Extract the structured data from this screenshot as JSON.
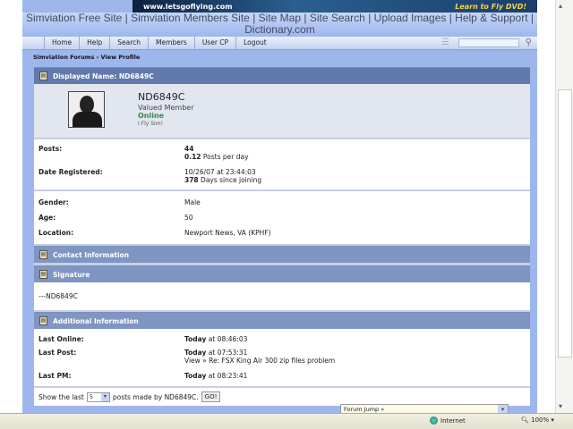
{
  "banner": {
    "left": "www.letsgoflying.com",
    "right": "Learn to Fly DVD!"
  },
  "toplinks": [
    "Simviation Free Site",
    "Simviation Members Site",
    "Site Map",
    "Site Search",
    "Upload Images",
    "Help & Support",
    "Dictionary.com"
  ],
  "menu": [
    "Home",
    "Help",
    "Search",
    "Members",
    "User CP",
    "Logout"
  ],
  "breadcrumb": "Simviation Forums › View Profile",
  "header": "Displayed Name: ND6849C",
  "profile": {
    "name": "ND6849C",
    "title": "Valued Member",
    "status": "Online",
    "motto": "I Fly Sim!"
  },
  "stats": {
    "posts_label": "Posts:",
    "posts": "44",
    "ppd": "0.12",
    "ppd_text": "Posts per day",
    "reg_label": "Date Registered:",
    "reg_date": "10/26/07 at 23:44:03",
    "days": "378",
    "days_text": "Days since joining"
  },
  "info": [
    {
      "label": "Gender:",
      "value": "Male"
    },
    {
      "label": "Age:",
      "value": "50"
    },
    {
      "label": "Location:",
      "value": "Newport News, VA (KPHF)"
    }
  ],
  "contact_header": "Contact Information",
  "signature_header": "Signature",
  "signature": "---ND6849C",
  "additional_header": "Additional Information",
  "additional": {
    "online_label": "Last Online:",
    "online_day": "Today",
    "online_time": "at 08:46:03",
    "post_label": "Last Post:",
    "post_day": "Today",
    "post_time": "at 07:53:31",
    "post_link": "View » Re: FSX King Air 300 zip files problem",
    "pm_label": "Last PM:",
    "pm_day": "Today",
    "pm_time": "at 08:23:41"
  },
  "showlast": {
    "pre": "Show the last",
    "count": "5",
    "post": "posts made by ND6849C.",
    "go": "GO!"
  },
  "forum_jump": "Forum Jump »",
  "statusbar": {
    "zone": "Internet",
    "zoom": "100%"
  }
}
